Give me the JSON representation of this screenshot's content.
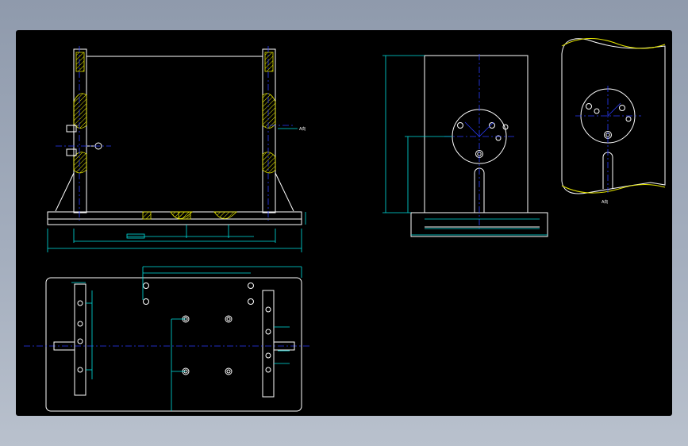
{
  "viewport": {
    "background": "#000000",
    "page_background": "#9aa4b5"
  },
  "colors": {
    "outline": "#ffffff",
    "dimension": "#00e0e0",
    "centerline": "#2a3cff",
    "section": "#e6e600"
  },
  "views": {
    "front": {
      "section_label": "A向"
    },
    "detail": {
      "label": "A向"
    }
  }
}
